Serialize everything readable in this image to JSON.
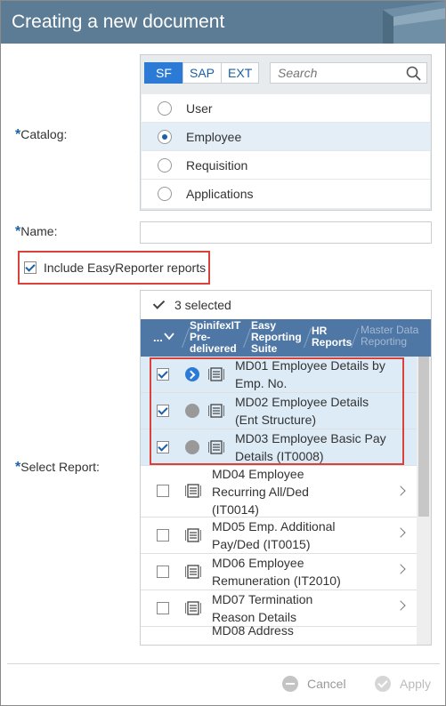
{
  "dialog": {
    "title": "Creating a new document"
  },
  "form": {
    "catalog_label": "Catalog:",
    "name_label": "Name:",
    "select_report_label": "Select Report:",
    "required_mark": "*",
    "name_value": ""
  },
  "catalog": {
    "sources": [
      {
        "label": "SF",
        "active": true
      },
      {
        "label": "SAP",
        "active": false
      },
      {
        "label": "EXT",
        "active": false
      }
    ],
    "search_placeholder": "Search",
    "options": [
      {
        "label": "User",
        "selected": false
      },
      {
        "label": "Employee",
        "selected": true
      },
      {
        "label": "Requisition",
        "selected": false
      },
      {
        "label": "Applications",
        "selected": false
      }
    ]
  },
  "include_easyreporter": {
    "label": "Include EasyReporter reports",
    "checked": true
  },
  "reports": {
    "selected_count_label": "3 selected",
    "breadcrumb": {
      "more": "...",
      "items": [
        {
          "label": "SpinifexIT Pre-delivered",
          "lines": [
            "SpinifexIT",
            "Pre-",
            "delivered"
          ]
        },
        {
          "label": "Easy Reporting Suite",
          "lines": [
            "Easy",
            "Reporting",
            "Suite"
          ]
        },
        {
          "label": "HR Reports",
          "lines": [
            "HR",
            "Reports"
          ]
        },
        {
          "label": "Master Data Reporting",
          "lines": [
            "Master Data",
            "Reporting"
          ]
        }
      ]
    },
    "rows": [
      {
        "lines": [
          "MD01 Employee Details by",
          "Emp. No."
        ],
        "checked": true,
        "status": "active",
        "highlight": true
      },
      {
        "lines": [
          "MD02 Employee Details",
          "(Ent Structure)"
        ],
        "checked": true,
        "status": "inactive",
        "highlight": true
      },
      {
        "lines": [
          "MD03 Employee Basic Pay",
          "Details (IT0008)"
        ],
        "checked": true,
        "status": "inactive",
        "highlight": true
      },
      {
        "lines": [
          "MD04 Employee",
          "Recurring All/Ded",
          "(IT0014)"
        ],
        "checked": false,
        "status": "none",
        "highlight": false
      },
      {
        "lines": [
          "MD05 Emp. Additional",
          "Pay/Ded (IT0015)"
        ],
        "checked": false,
        "status": "none",
        "highlight": false
      },
      {
        "lines": [
          "MD06 Employee",
          "Remuneration (IT2010)"
        ],
        "checked": false,
        "status": "none",
        "highlight": false
      },
      {
        "lines": [
          "MD07 Termination",
          "Reason Details"
        ],
        "checked": false,
        "status": "none",
        "highlight": false
      },
      {
        "lines": [
          "MD08 Address"
        ],
        "checked": false,
        "status": "none",
        "highlight": false
      }
    ]
  },
  "footer": {
    "cancel_label": "Cancel",
    "apply_label": "Apply"
  },
  "colors": {
    "title_bar": "#5b7c94",
    "accent": "#2b7bd6",
    "breadcrumb_bar": "#4f77a6",
    "highlight_row": "#dcebf6",
    "annotation_red": "#d9413a"
  }
}
